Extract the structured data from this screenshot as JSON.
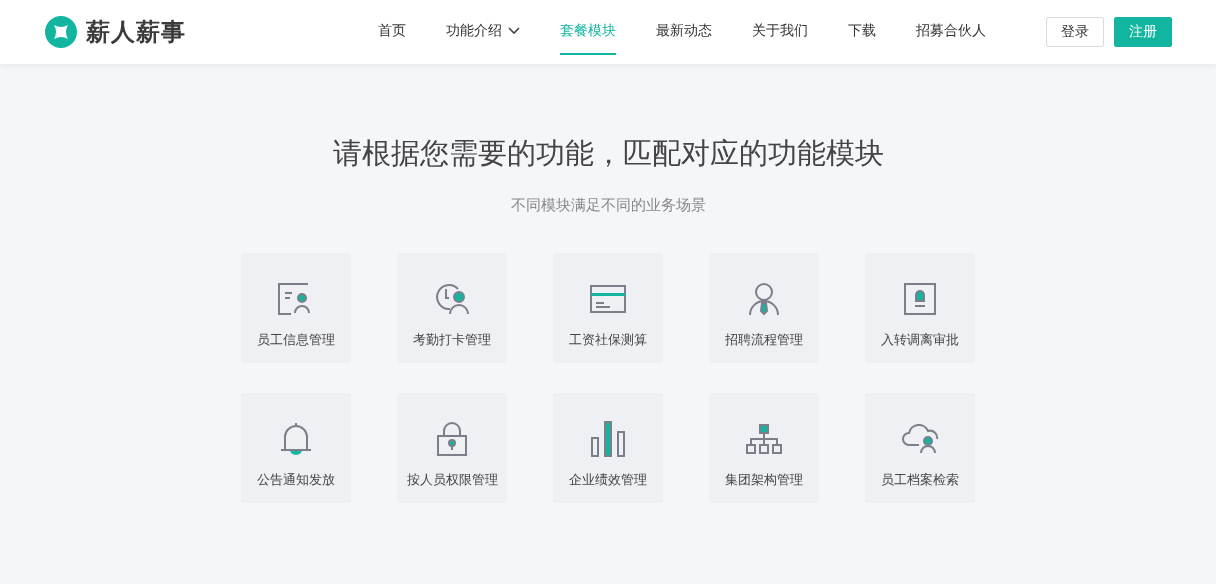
{
  "brand": {
    "name": "薪人薪事"
  },
  "nav": [
    {
      "label": "首页",
      "selected": false,
      "dropdown": false
    },
    {
      "label": "功能介绍",
      "selected": false,
      "dropdown": true
    },
    {
      "label": "套餐模块",
      "selected": true,
      "dropdown": false
    },
    {
      "label": "最新动态",
      "selected": false,
      "dropdown": false
    },
    {
      "label": "关于我们",
      "selected": false,
      "dropdown": false
    },
    {
      "label": "下载",
      "selected": false,
      "dropdown": false
    },
    {
      "label": "招募合伙人",
      "selected": false,
      "dropdown": false
    }
  ],
  "login_button": "登录",
  "signup_button": "注册",
  "heading": "请根据您需要的功能，匹配对应的功能模块",
  "subheading": "不同模块满足不同的业务场景",
  "modules": [
    {
      "kind": "profile",
      "label": "员工信息管理"
    },
    {
      "kind": "clock",
      "label": "考勤打卡管理"
    },
    {
      "kind": "card",
      "label": "工资社保测算"
    },
    {
      "kind": "person",
      "label": "招聘流程管理"
    },
    {
      "kind": "badge",
      "label": "入转调离审批"
    },
    {
      "kind": "bell",
      "label": "公告通知发放"
    },
    {
      "kind": "lock",
      "label": "按人员权限管理"
    },
    {
      "kind": "bars",
      "label": "企业绩效管理"
    },
    {
      "kind": "org",
      "label": "集团架构管理"
    },
    {
      "kind": "cloud",
      "label": "员工档案检索"
    }
  ]
}
